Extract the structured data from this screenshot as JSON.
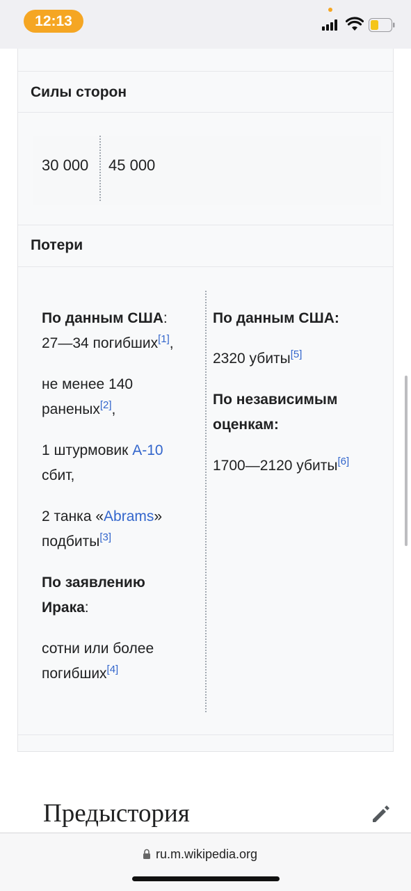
{
  "status_bar": {
    "time": "12:13"
  },
  "infobox": {
    "forces": {
      "heading": "Силы сторон",
      "left_value": "30 000",
      "right_value": "45 000"
    },
    "losses": {
      "heading": "Потери",
      "left": {
        "us_label": "По данным США",
        "us_colon": ":",
        "killed_text": "27—34 погибших",
        "ref1": "[1]",
        "comma1": ",",
        "wounded_line1": "не менее 140",
        "wounded_line2": "раненых",
        "ref2": "[2]",
        "comma2": ",",
        "attack_prefix": "1 штурмовик ",
        "attack_link": "A-10",
        "attack_line2": "сбит,",
        "tanks_prefix": "2 танка «",
        "tanks_link": "Abrams",
        "tanks_suffix": "»",
        "tanks_line2": "подбиты",
        "ref3": "[3]",
        "iraq_label_line1": "По заявлению",
        "iraq_label_line2": "Ирака",
        "iraq_colon": ":",
        "iraq_line1": "сотни или более",
        "iraq_line2": "погибших",
        "ref4": "[4]"
      },
      "right": {
        "us_label": "По данным США:",
        "killed_text": "2320 убиты",
        "ref5": "[5]",
        "independent_line1": "По независимым",
        "independent_line2": "оценкам:",
        "indep_text": "1700—2120 убиты",
        "ref6": "[6]"
      }
    }
  },
  "section": {
    "title": "Предыстория",
    "edit_icon": "pencil-icon"
  },
  "browser": {
    "url": "ru.m.wikipedia.org",
    "lock_icon": "lock-icon"
  },
  "colors": {
    "link": "#3366cc",
    "time_pill": "#f5a623"
  }
}
